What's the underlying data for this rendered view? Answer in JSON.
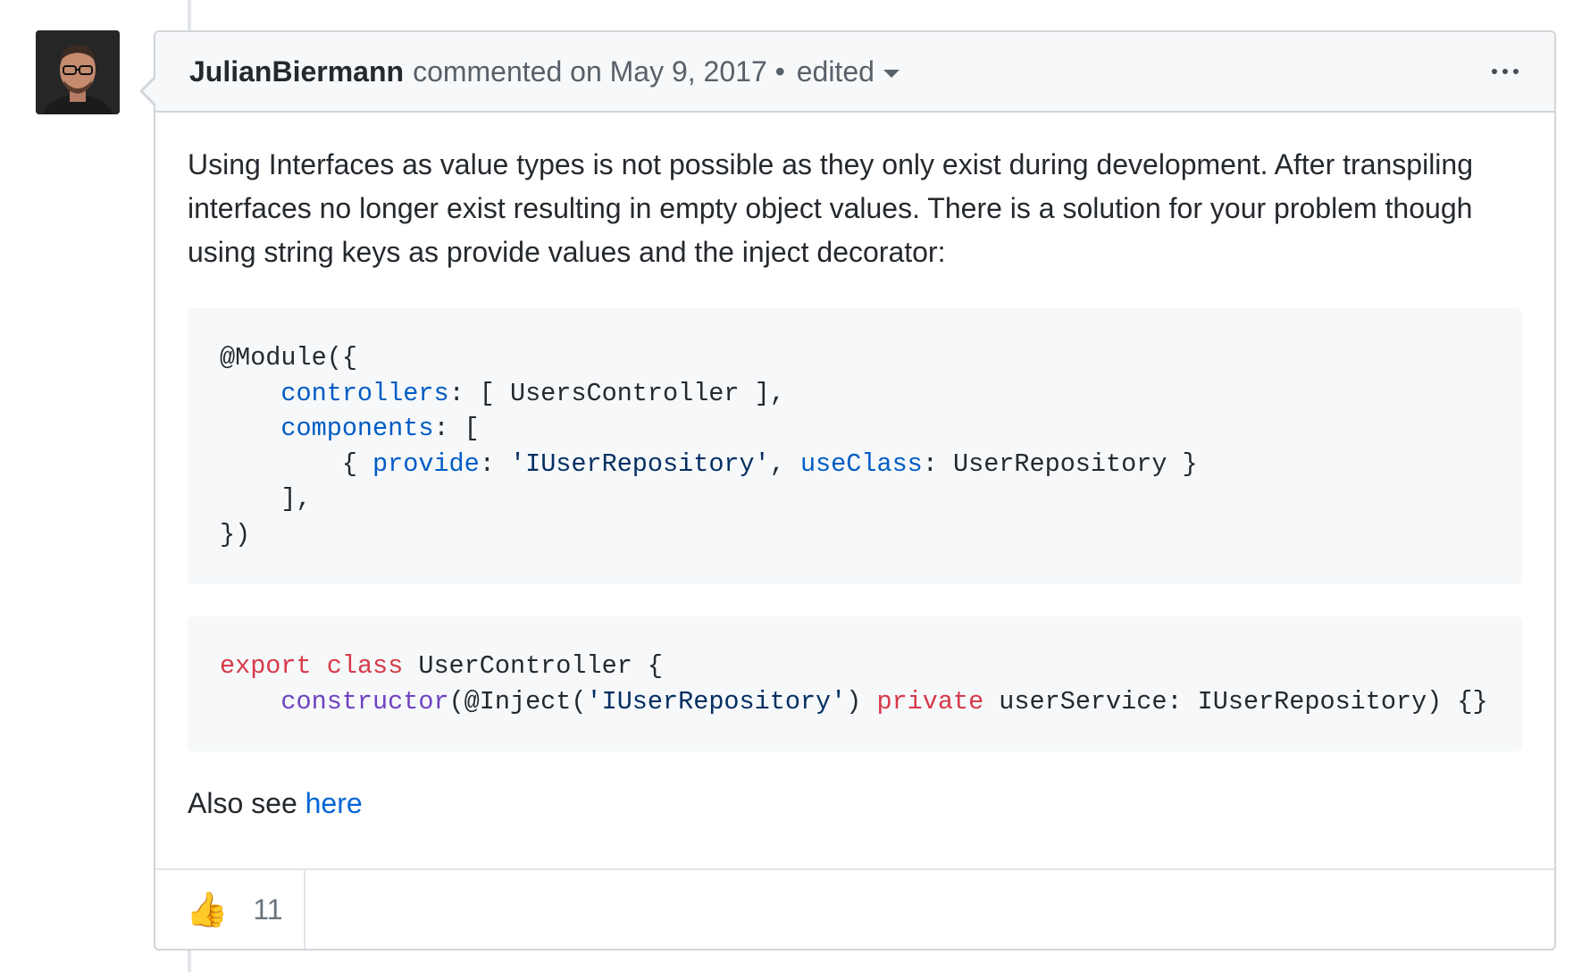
{
  "comment": {
    "author": "JulianBiermann",
    "action": "commented on",
    "date": "May 9, 2017",
    "separator": "•",
    "edited_label": "edited",
    "more_icon": "kebab-horizontal-icon",
    "avatar_icon": "user-avatar-photo"
  },
  "body": {
    "paragraph": "Using Interfaces as value types is not possible as they only exist during development. After transpiling interfaces no longer exist resulting in empty object values. There is a solution for your problem though using string keys as provide values and the inject decorator:",
    "also_see_prefix": "Also see ",
    "also_see_link": "here"
  },
  "code1": {
    "l1": "@Module({",
    "l2_indent": "    ",
    "l2_key": "controllers",
    "l2_rest": ": [ UsersController ],",
    "l3_indent": "    ",
    "l3_key": "components",
    "l3_rest": ": [",
    "l4_indent": "        { ",
    "l4_key1": "provide",
    "l4_sep1": ": ",
    "l4_str": "'IUserRepository'",
    "l4_sep2": ", ",
    "l4_key2": "useClass",
    "l4_rest": ": UserRepository }",
    "l5": "    ],",
    "l6": "})"
  },
  "code2": {
    "l1_kw1": "export",
    "l1_sp": " ",
    "l1_kw2": "class",
    "l1_rest": " UserController {",
    "l2_indent": "    ",
    "l2_fn": "constructor",
    "l2_a": "(@Inject(",
    "l2_str": "'IUserRepository'",
    "l2_b": ") ",
    "l2_kw": "private",
    "l2_rest": " userService: IUserRepository) {}"
  },
  "reactions": {
    "thumbs_up_icon": "thumbs-up-icon",
    "thumbs_up_emoji": "👍",
    "thumbs_up_count": "11"
  },
  "colors": {
    "link": "#0366d6",
    "keyword": "#d73a49",
    "property": "#005cc5",
    "string": "#032f62",
    "function": "#6f42c1"
  }
}
